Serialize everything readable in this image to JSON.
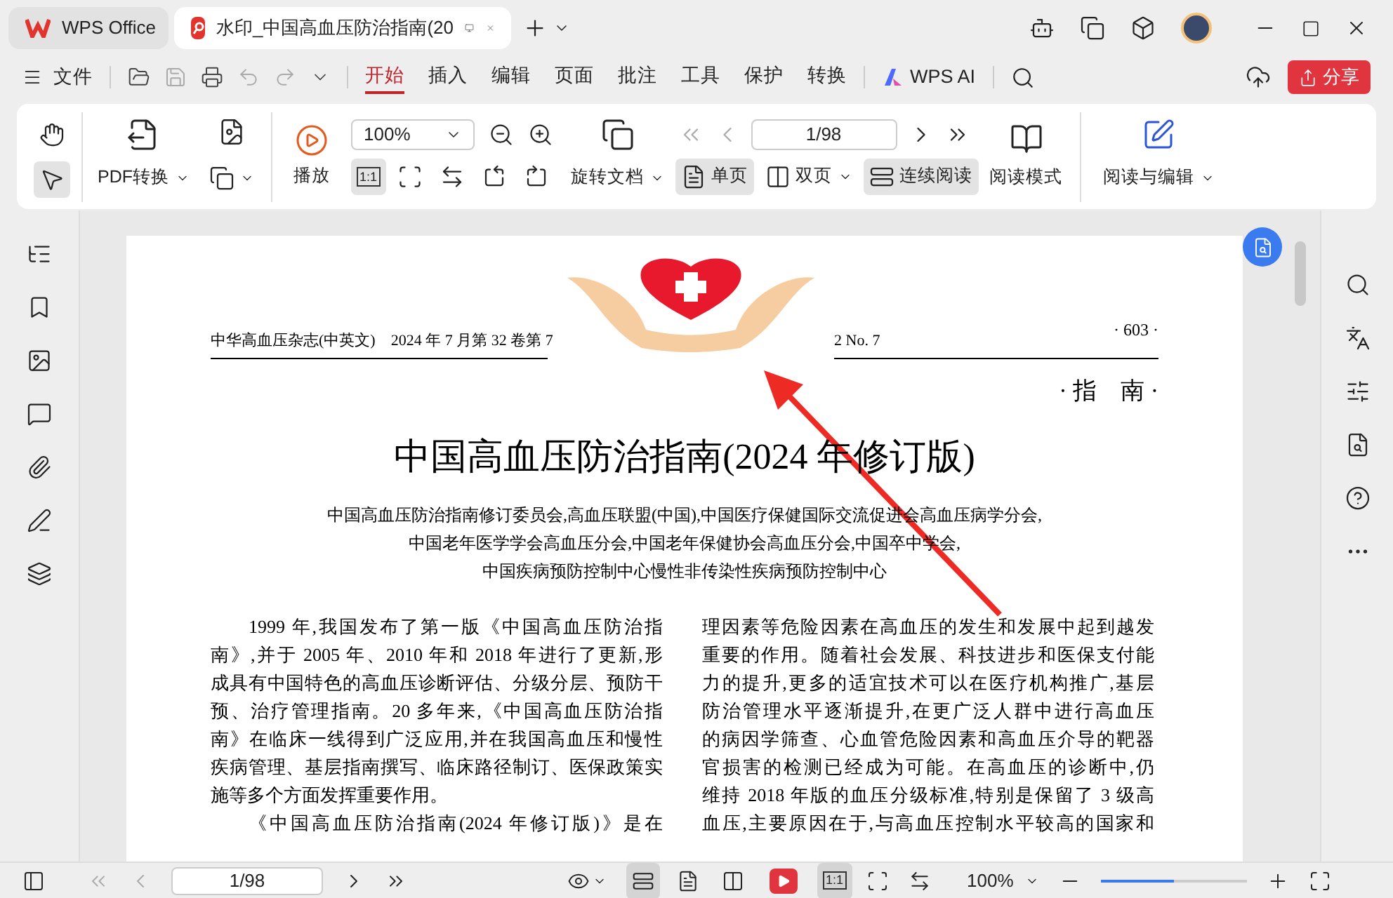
{
  "title_bar": {
    "tabs": [
      {
        "kind": "home",
        "label": "WPS Office",
        "selected": false
      },
      {
        "kind": "doc",
        "label": "水印_中国高血压防治指南(20",
        "selected": true
      }
    ]
  },
  "menu_bar": {
    "file": "文件",
    "tabs": [
      {
        "label": "开始",
        "selected": true
      },
      {
        "label": "插入",
        "selected": false
      },
      {
        "label": "编辑",
        "selected": false
      },
      {
        "label": "页面",
        "selected": false
      },
      {
        "label": "批注",
        "selected": false
      },
      {
        "label": "工具",
        "selected": false
      },
      {
        "label": "保护",
        "selected": false
      },
      {
        "label": "转换",
        "selected": false
      }
    ],
    "ai": "WPS AI",
    "share": "分享"
  },
  "ribbon": {
    "tools": [
      {
        "kind": "hand",
        "selected": false
      },
      {
        "kind": "select",
        "selected": true
      }
    ],
    "pdf_convert": "PDF转换",
    "play": "播放",
    "zoom": "100%",
    "fit_buttons": [
      {
        "kind": "actual",
        "label": "1:1",
        "selected": true
      },
      {
        "kind": "page",
        "selected": false
      },
      {
        "kind": "width",
        "selected": false
      },
      {
        "kind": "rotl",
        "selected": false
      },
      {
        "kind": "rotr",
        "selected": false
      }
    ],
    "rotate": "旋转文档",
    "views": [
      {
        "label": "单页",
        "kind": "single",
        "selected": true,
        "caret": false
      },
      {
        "label": "双页",
        "kind": "double",
        "selected": false,
        "caret": true
      },
      {
        "label": "连续阅读",
        "kind": "continuous",
        "selected": true,
        "caret": false
      }
    ],
    "page": "1/98",
    "read_mode": "阅读模式",
    "read_edit": "阅读与编辑"
  },
  "document": {
    "journal_left": "中华高血压杂志(中英文)　2024 年 7 月第 32 卷第 7",
    "journal_right": "2 No. 7",
    "page_number": "· 603 ·",
    "section": "· 指　南 ·",
    "title": "中国高血压防治指南(2024 年修订版)",
    "authors": [
      "中国高血压防治指南修订委员会,高血压联盟(中国),中国医疗保健国际交流促进会高血压病学分会,",
      "中国老年医学学会高血压分会,中国老年保健协会高血压分会,中国卒中学会,",
      "中国疾病预防控制中心慢性非传染性疾病预防控制中心"
    ],
    "column_1": [
      {
        "text": "1999 年,我国发布了第一版《中国高血压防治指",
        "indent": true
      },
      {
        "text": "南》,并于 2005 年、2010 年和 2018 年进行了更新,形",
        "indent": false
      },
      {
        "text": "成具有中国特色的高血压诊断评估、分级分层、预防干",
        "indent": false
      },
      {
        "text": "预、治疗管理指南。20 多年来,《中国高血压防治指",
        "indent": false
      },
      {
        "text": "南》在临床一线得到广泛应用,并在我国高血压和慢性",
        "indent": false
      },
      {
        "text": "疾病管理、基层指南撰写、临床路径制订、医保政策实",
        "indent": false
      },
      {
        "text": "施等多个方面发挥重要作用。",
        "indent": false
      },
      {
        "text": "《中国高血压防治指南(2024 年修订版)》是在",
        "indent": true
      }
    ],
    "column_2": [
      {
        "text": "理因素等危险因素在高血压的发生和发展中起到越发",
        "indent": false
      },
      {
        "text": "重要的作用。随着社会发展、科技进步和医保支付能",
        "indent": false
      },
      {
        "text": "力的提升,更多的适宜技术可以在医疗机构推广,基层",
        "indent": false
      },
      {
        "text": "防治管理水平逐渐提升,在更广泛人群中进行高血压",
        "indent": false
      },
      {
        "text": "的病因学筛查、心血管危险因素和高血压介导的靶器",
        "indent": false
      },
      {
        "text": "官损害的检测已经成为可能。在高血压的诊断中,仍",
        "indent": false
      },
      {
        "text": "维持 2018 年版的血压分级标准,特别是保留了 3 级高",
        "indent": false
      },
      {
        "text": "血压,主要原因在于,与高血压控制水平较高的国家和",
        "indent": false
      }
    ]
  },
  "status_bar": {
    "page": "1/98",
    "views": [
      {
        "kind": "continuous",
        "selected": true
      },
      {
        "kind": "single",
        "selected": false
      },
      {
        "kind": "double",
        "selected": false
      }
    ],
    "fits": [
      {
        "kind": "actual",
        "label": "1:1",
        "selected": true
      },
      {
        "kind": "page",
        "selected": false
      },
      {
        "kind": "width",
        "selected": false
      }
    ],
    "zoom": "100%",
    "zoom_slider": {
      "level": 0.5
    }
  }
}
